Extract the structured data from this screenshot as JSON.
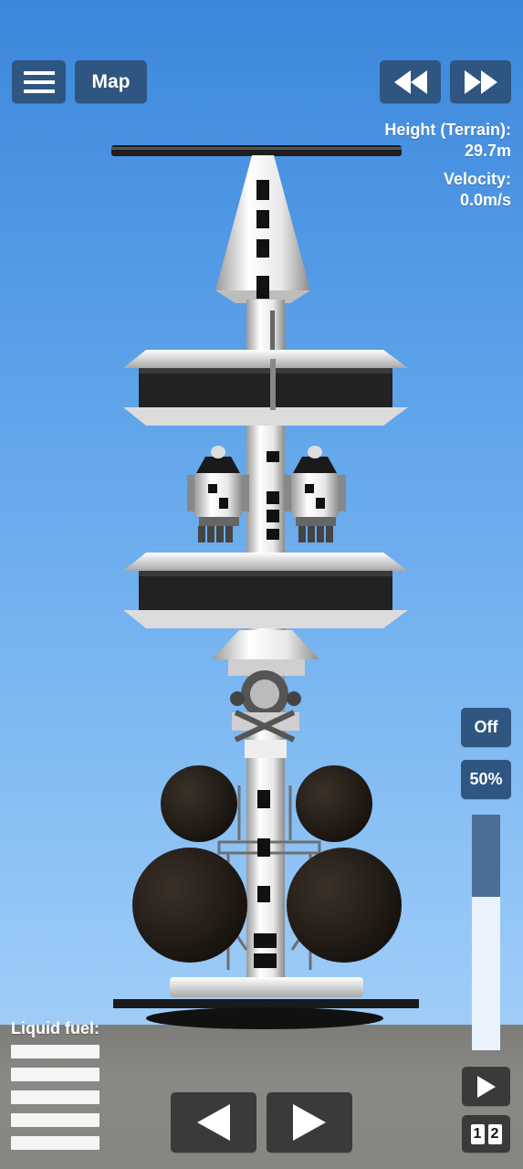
{
  "hud": {
    "map_label": "Map",
    "height_label": "Height (Terrain):",
    "height_value": "29.7m",
    "velocity_label": "Velocity:",
    "velocity_value": "0.0m/s",
    "throttle_off_label": "Off",
    "throttle_percent_label": "50%",
    "throttle_level": 0.5,
    "liquid_fuel_label": "Liquid fuel:",
    "part_indicator_1": "1",
    "part_indicator_2": "2"
  },
  "icons": {
    "menu": "hamburger-icon",
    "rewind": "rewind-icon",
    "fast_forward": "fast-forward-icon",
    "rotate_left": "arrow-left-icon",
    "rotate_right": "arrow-right-icon",
    "stage": "play-icon"
  },
  "colors": {
    "sky_top": "#3c87dc",
    "sky_bottom": "#a9d2f8",
    "button": "#2f5680",
    "ground": "#858480",
    "throttle_fill": "#4a6e96"
  }
}
